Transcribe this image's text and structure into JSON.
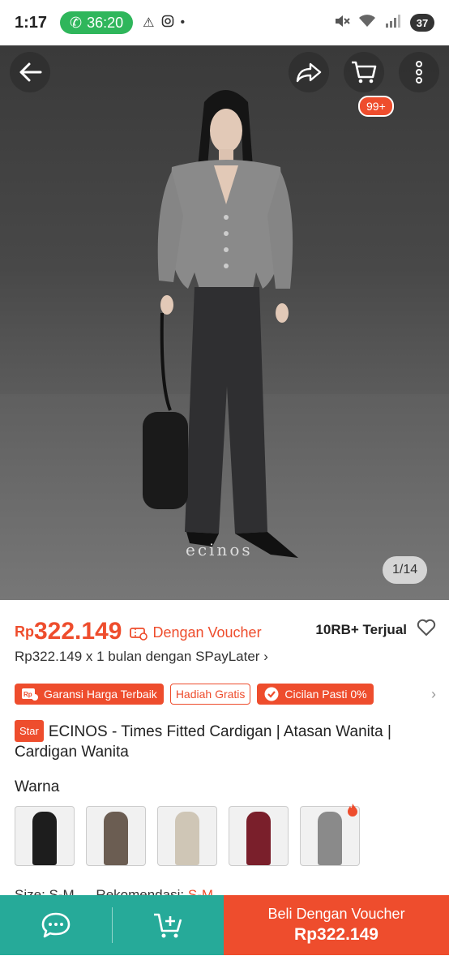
{
  "status_bar": {
    "time": "1:17",
    "call_timer": "36:20",
    "battery": "37"
  },
  "header": {
    "cart_badge": "99+"
  },
  "gallery": {
    "brand_mark": "ecinos",
    "page_indicator": "1/14"
  },
  "product": {
    "currency": "Rp",
    "price": "322.149",
    "voucher_label": "Dengan Voucher",
    "sold": "10RB+ Terjual",
    "paylater": "Rp322.149 x 1 bulan dengan SPayLater",
    "badges": [
      "Garansi Harga Terbaik",
      "Hadiah Gratis",
      "Cicilan Pasti 0%"
    ],
    "star_tag": "Star",
    "title": "ECINOS - Times Fitted Cardigan | Atasan Wanita | Cardigan Wanita",
    "variant_label": "Warna",
    "swatch_colors": [
      "#1d1d1d",
      "#6b5d52",
      "#cfc6b6",
      "#7a1f2b",
      "#8a8a8a"
    ],
    "size_label": "Size: S-M",
    "recommend_label": "Rekomendasi:",
    "recommend_value": "S-M"
  },
  "bottom_bar": {
    "buy_label": "Beli Dengan Voucher",
    "buy_price": "Rp322.149"
  },
  "colors": {
    "accent": "#ee4d2d",
    "teal": "#26aa99"
  }
}
